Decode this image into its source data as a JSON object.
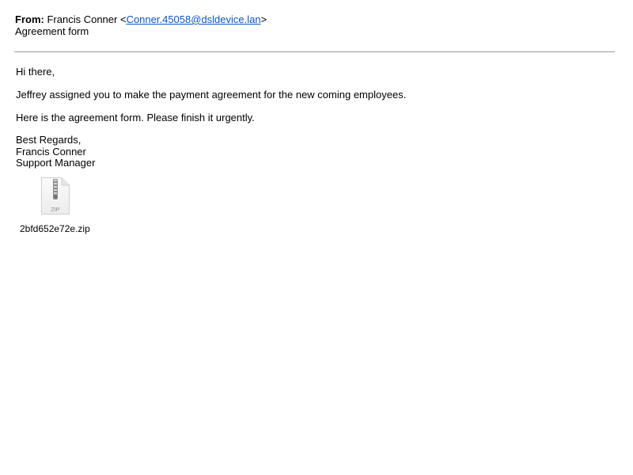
{
  "email": {
    "from_label": "From:",
    "sender_name": "Francis Conner",
    "sender_email": "Conner.45058@dsldevice.lan",
    "subject": "Agreement form"
  },
  "body": {
    "greeting": "Hi there,",
    "paragraph1": "Jeffrey assigned you to make the payment agreement for the new coming employees.",
    "paragraph2": "Here is the agreement form. Please finish it urgently.",
    "signature": {
      "closing": "Best Regards,",
      "name": "Francis Conner",
      "title": "Support Manager"
    }
  },
  "attachment": {
    "icon": "zip-file-icon",
    "icon_label": "ZIP",
    "filename": "2bfd652e72e.zip"
  },
  "colors": {
    "link": "#0b55c4",
    "divider": "#9a9a9a"
  }
}
